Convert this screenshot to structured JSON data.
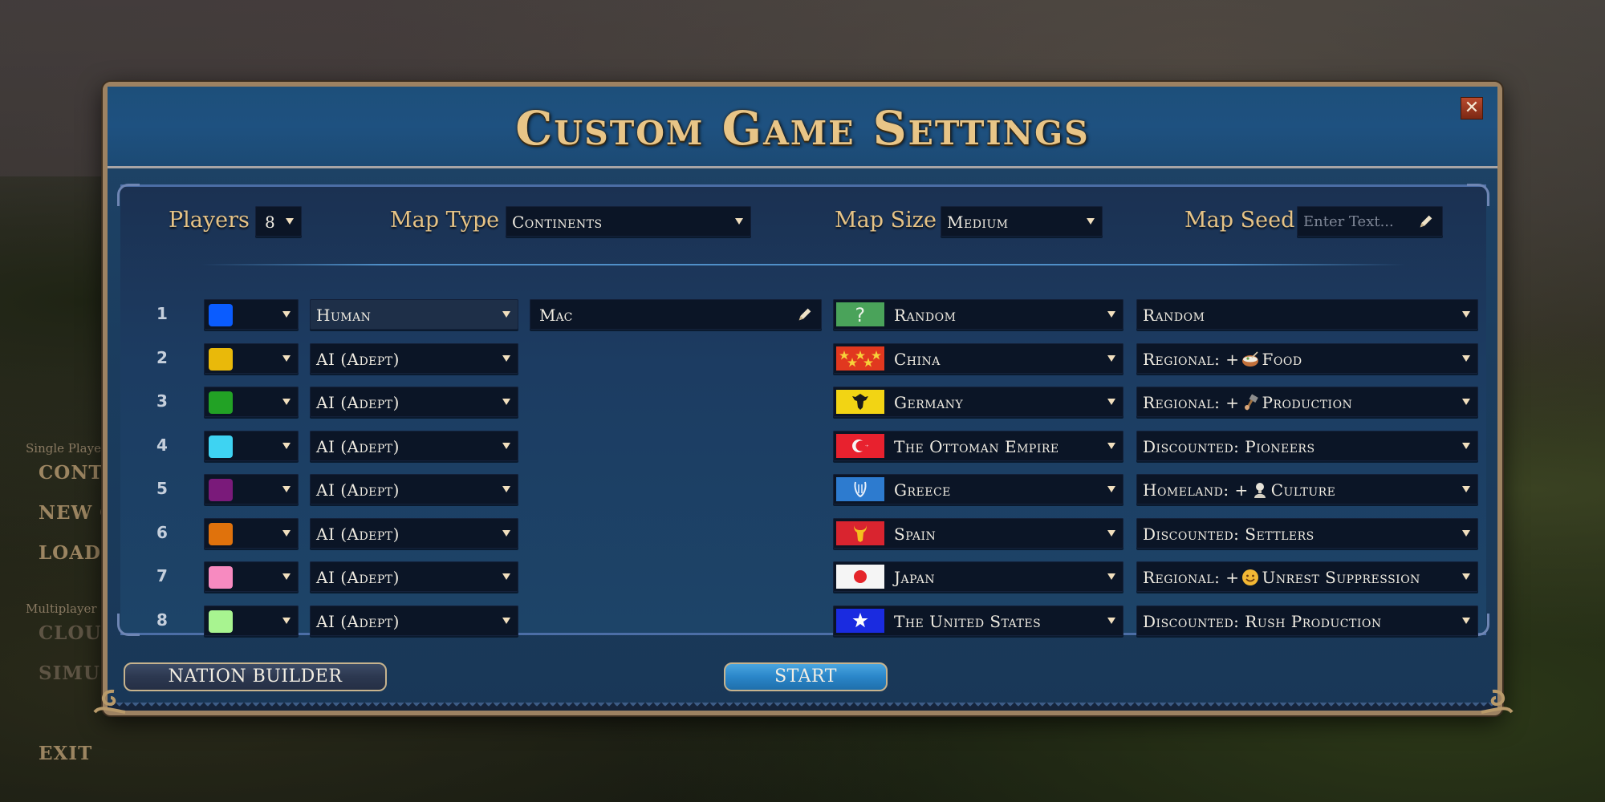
{
  "background_menu": {
    "sections": [
      {
        "label": "Single Player",
        "items": [
          "CONTINUE",
          "NEW GAME",
          "LOAD GAME"
        ]
      },
      {
        "label": "Multiplayer",
        "items": [
          "CLOUD",
          "SIMULTANEOUS"
        ]
      }
    ],
    "visible_fragments": {
      "single_player": "Single Player",
      "continue": "CONTI",
      "new_game": "NEW G",
      "load_game": "LOAD",
      "multiplayer": "Multiplayer",
      "cloud": "CLOUD",
      "simul": "SIMUL",
      "exit": "EXIT"
    }
  },
  "dialog": {
    "title": "Custom Game Settings",
    "close_icon": "close-icon",
    "settings": {
      "players_label": "Players",
      "players_value": "8",
      "map_type_label": "Map Type",
      "map_type_value": "Continents",
      "map_size_label": "Map Size",
      "map_size_value": "Medium",
      "map_seed_label": "Map Seed",
      "map_seed_placeholder": "Enter Text...",
      "map_seed_value": ""
    },
    "players": [
      {
        "num": "1",
        "color": "#0a5cff",
        "type": "Human",
        "name": "Mac",
        "nation": "Random",
        "flag": "random",
        "bonus_prefix": "Random",
        "bonus_icon": null,
        "bonus_suffix": ""
      },
      {
        "num": "2",
        "color": "#e9b90a",
        "type": "AI (Adept)",
        "name": "",
        "nation": "China",
        "flag": "china",
        "bonus_prefix": "Regional: +",
        "bonus_icon": "food-icon",
        "bonus_suffix": "Food"
      },
      {
        "num": "3",
        "color": "#22a225",
        "type": "AI (Adept)",
        "name": "",
        "nation": "Germany",
        "flag": "germany",
        "bonus_prefix": "Regional: +",
        "bonus_icon": "production-hammer-icon",
        "bonus_suffix": "Production"
      },
      {
        "num": "4",
        "color": "#3ed3f2",
        "type": "AI (Adept)",
        "name": "",
        "nation": "The Ottoman Empire",
        "flag": "ottoman",
        "bonus_prefix": "Discounted: Pioneers",
        "bonus_icon": null,
        "bonus_suffix": ""
      },
      {
        "num": "5",
        "color": "#7a1a7a",
        "type": "AI (Adept)",
        "name": "",
        "nation": "Greece",
        "flag": "greece",
        "bonus_prefix": "Homeland: +",
        "bonus_icon": "culture-bust-icon",
        "bonus_suffix": "Culture"
      },
      {
        "num": "6",
        "color": "#e0720c",
        "type": "AI (Adept)",
        "name": "",
        "nation": "Spain",
        "flag": "spain",
        "bonus_prefix": "Discounted: Settlers",
        "bonus_icon": null,
        "bonus_suffix": ""
      },
      {
        "num": "7",
        "color": "#f78ac0",
        "type": "AI (Adept)",
        "name": "",
        "nation": "Japan",
        "flag": "japan",
        "bonus_prefix": "Regional: +",
        "bonus_icon": "unrest-smiley-icon",
        "bonus_suffix": "Unrest Suppression"
      },
      {
        "num": "8",
        "color": "#a8f490",
        "type": "AI (Adept)",
        "name": "",
        "nation": "The United States",
        "flag": "usa",
        "bonus_prefix": "Discounted: Rush Production",
        "bonus_icon": null,
        "bonus_suffix": ""
      }
    ],
    "buttons": {
      "nation_builder": "NATION BUILDER",
      "start": "START"
    }
  },
  "colors": {
    "gold_text": "#e6c386",
    "frame": "#9d8262",
    "panel_blue": "#1b3d5f",
    "start_blue": "#2a86c9",
    "close_red": "#9e3820"
  }
}
